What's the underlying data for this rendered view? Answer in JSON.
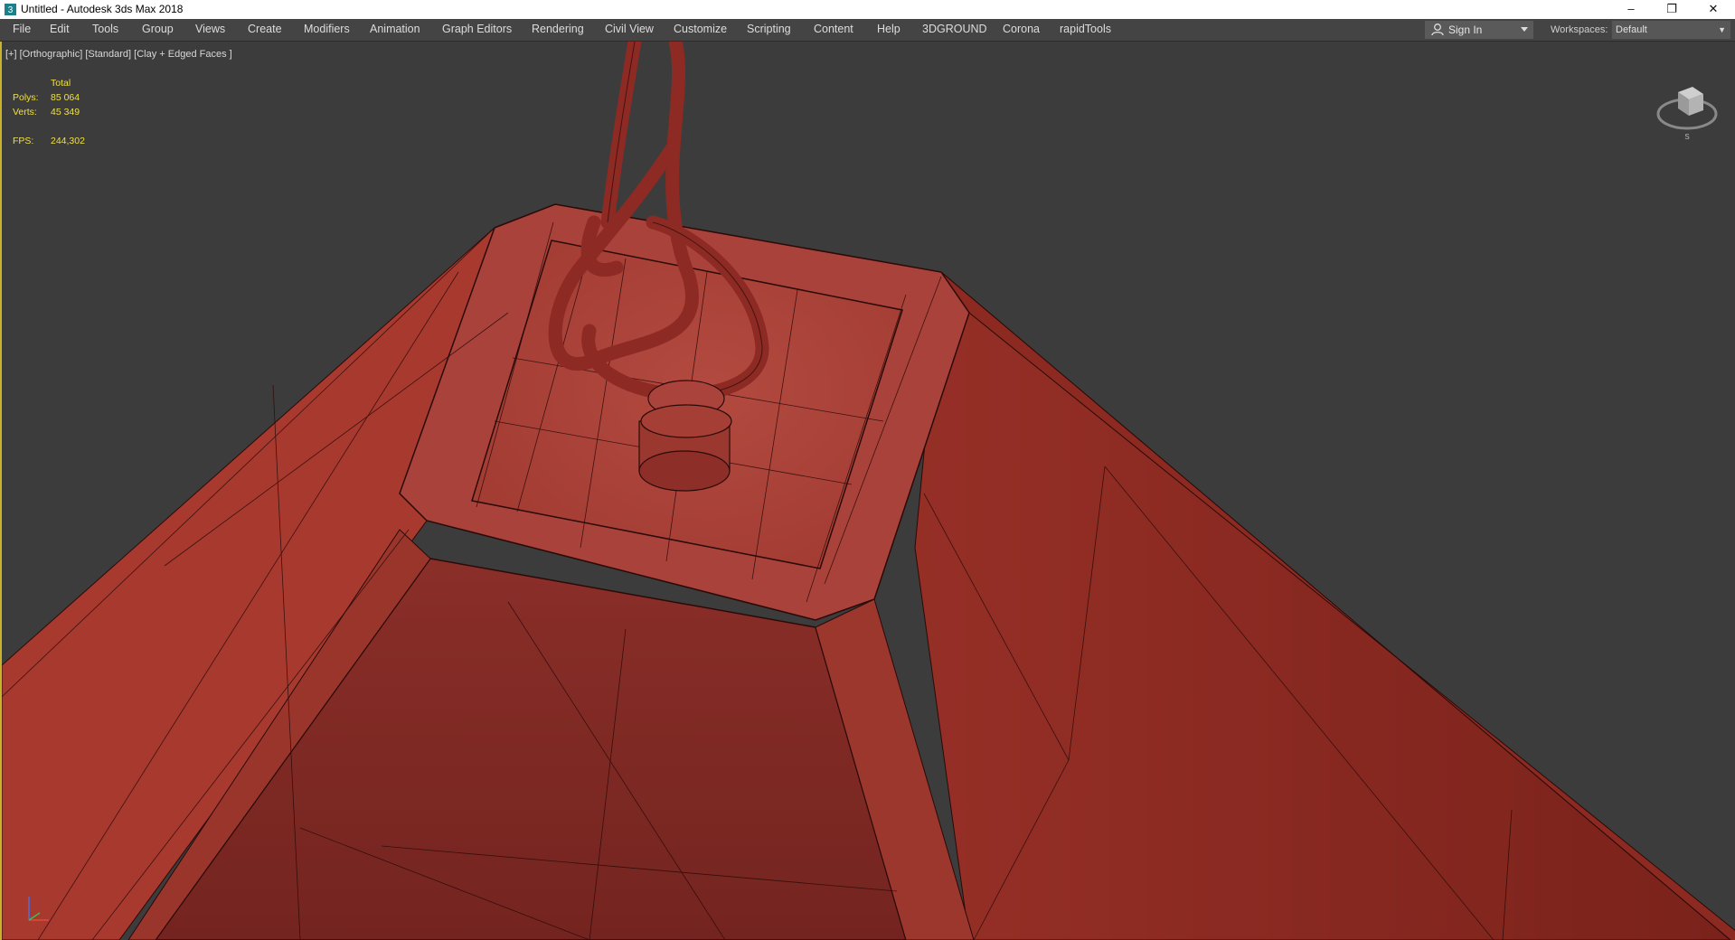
{
  "window": {
    "title": "Untitled - Autodesk 3ds Max 2018",
    "controls": {
      "minimize": "–",
      "restore": "❐",
      "close": "✕"
    }
  },
  "menu": {
    "items": [
      "File",
      "Edit",
      "Tools",
      "Group",
      "Views",
      "Create",
      "Modifiers",
      "Animation",
      "Graph Editors",
      "Rendering",
      "Civil View",
      "Customize",
      "Scripting",
      "Content",
      "Help",
      "3DGROUND",
      "Corona",
      "rapidTools"
    ]
  },
  "signin": {
    "label": "Sign In"
  },
  "workspaces": {
    "label": "Workspaces:",
    "value": "Default"
  },
  "viewport": {
    "label": "[+] [Orthographic] [Standard] [Clay + Edged Faces ]",
    "stats": {
      "header": "Total",
      "polys_label": "Polys:",
      "polys": "85 064",
      "verts_label": "Verts:",
      "verts": "45 349",
      "fps_label": "FPS:",
      "fps": "244,302"
    }
  },
  "colors": {
    "viewport_bg": "#3c3c3c",
    "clay": "#b9483f",
    "highlight": "#f0e040",
    "menubar": "#444444"
  }
}
